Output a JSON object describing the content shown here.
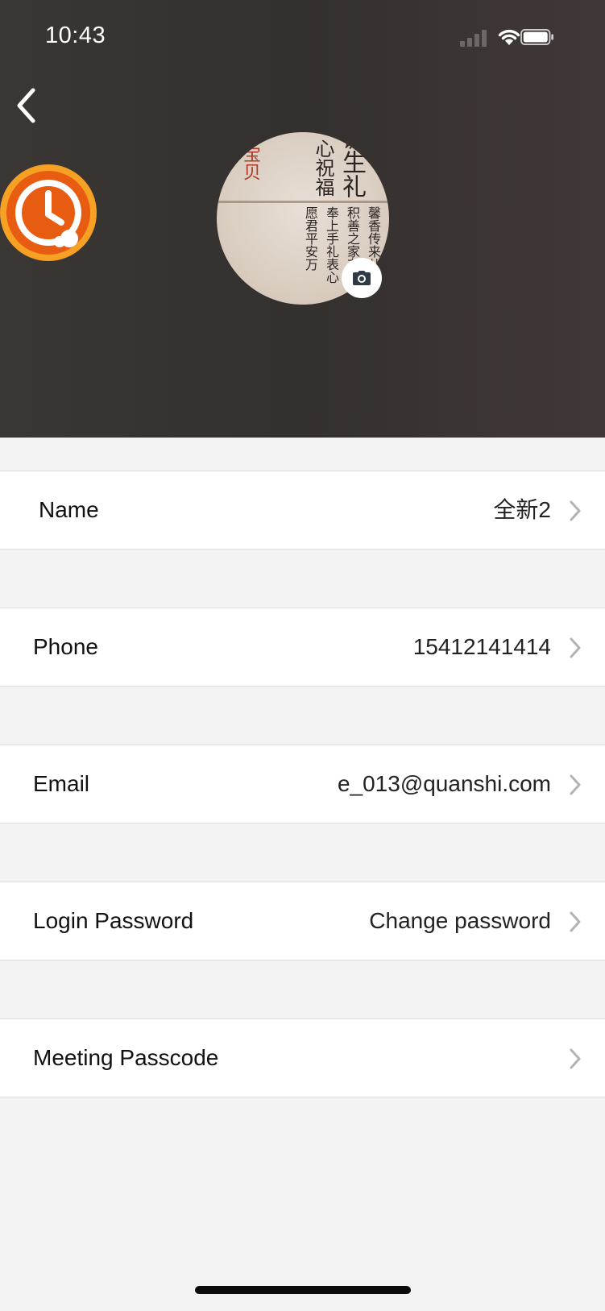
{
  "status_bar": {
    "time": "10:43"
  },
  "rows": [
    {
      "label": "Name",
      "value": "全新2"
    },
    {
      "label": "Phone",
      "value": "15412141414"
    },
    {
      "label": "Email",
      "value": "e_013@quanshi.com"
    },
    {
      "label": "Login Password",
      "value": "Change password"
    },
    {
      "label": "Meeting Passcode",
      "value": ""
    }
  ],
  "avatar_image_text": {
    "col1": "诞生礼",
    "col2": "心祝福",
    "col3": "宝贝",
    "col4": "馨香传来儿啼声",
    "col5": "积善之家有福临",
    "col6": "奉上手礼表心",
    "col7": "愿君平安万"
  },
  "colors": {
    "header_bg": "#3a3634",
    "page_bg": "#f3f3f3",
    "logo_orange": "#f07a1a",
    "chevron": "#b3b3b3"
  },
  "icons": {
    "back": "chevron-left-icon",
    "camera": "camera-icon",
    "chevron": "chevron-right-icon",
    "app_logo": "clock-cloud-logo"
  }
}
